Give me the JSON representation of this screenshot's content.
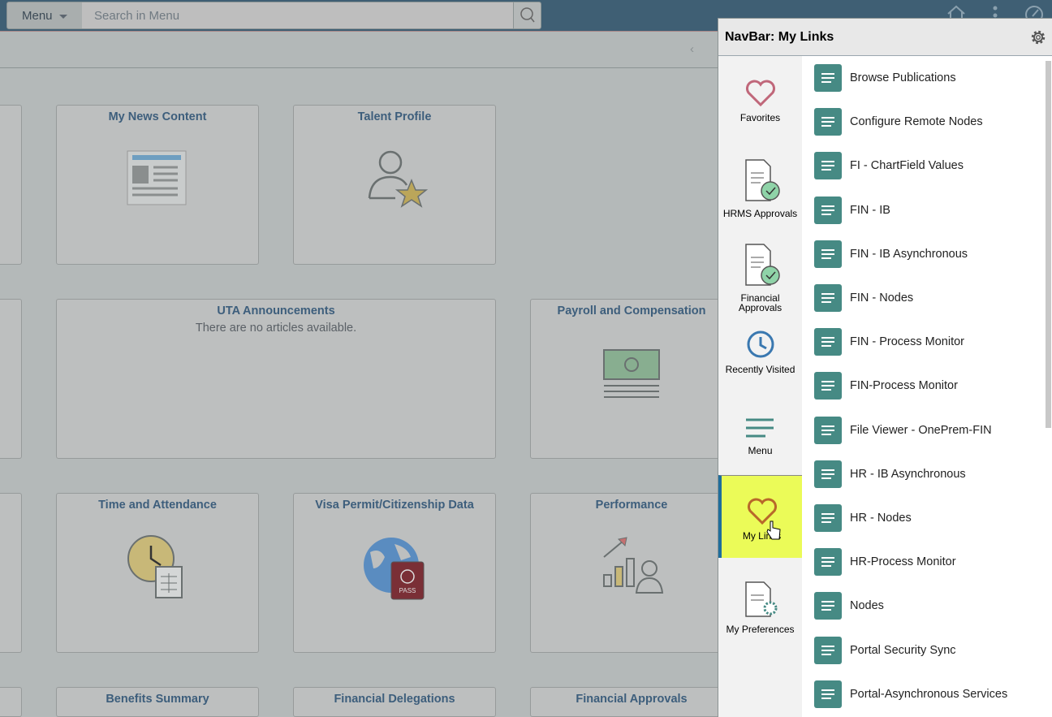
{
  "header": {
    "menu_label": "Menu",
    "search_placeholder": "Search in Menu"
  },
  "tiles": [
    {
      "title": "My News Content",
      "icon": "newspaper-icon"
    },
    {
      "title": "Talent Profile",
      "icon": "person-star-icon"
    },
    {
      "title": "UTA Announcements",
      "subtitle": "There are no articles available."
    },
    {
      "title": "Payroll and Compensation",
      "icon": "money-icon"
    },
    {
      "title": "Time and Attendance",
      "icon": "clock-sheet-icon"
    },
    {
      "title": "Visa Permit/Citizenship Data",
      "icon": "globe-passport-icon",
      "passport_text": "PASS"
    },
    {
      "title": "Performance",
      "icon": "chart-person-icon"
    },
    {
      "title": "Benefits Summary"
    },
    {
      "title": "Financial Delegations"
    },
    {
      "title": "Financial Approvals"
    }
  ],
  "panel": {
    "title": "NavBar: My Links",
    "nav": [
      {
        "label": "Favorites"
      },
      {
        "label": "HRMS Approvals"
      },
      {
        "label": "Financial Approvals"
      },
      {
        "label": "Recently Visited"
      },
      {
        "label": "Menu"
      },
      {
        "label": "My Links",
        "active": true
      },
      {
        "label": "My Preferences"
      }
    ],
    "links": [
      "Browse Publications",
      "Configure Remote Nodes",
      "FI - ChartField Values",
      "FIN - IB",
      "FIN - IB Asynchronous",
      "FIN - Nodes",
      "FIN - Process Monitor",
      "FIN-Process Monitor",
      "File Viewer - OnePrem-FIN",
      "HR - IB Asynchronous",
      "HR - Nodes",
      "HR-Process Monitor",
      "Nodes",
      "Portal Security Sync",
      "Portal-Asynchronous Services"
    ]
  },
  "colors": {
    "accent": "#468a84",
    "active_nav": "#ebfb58",
    "header": "#3f5f74"
  }
}
